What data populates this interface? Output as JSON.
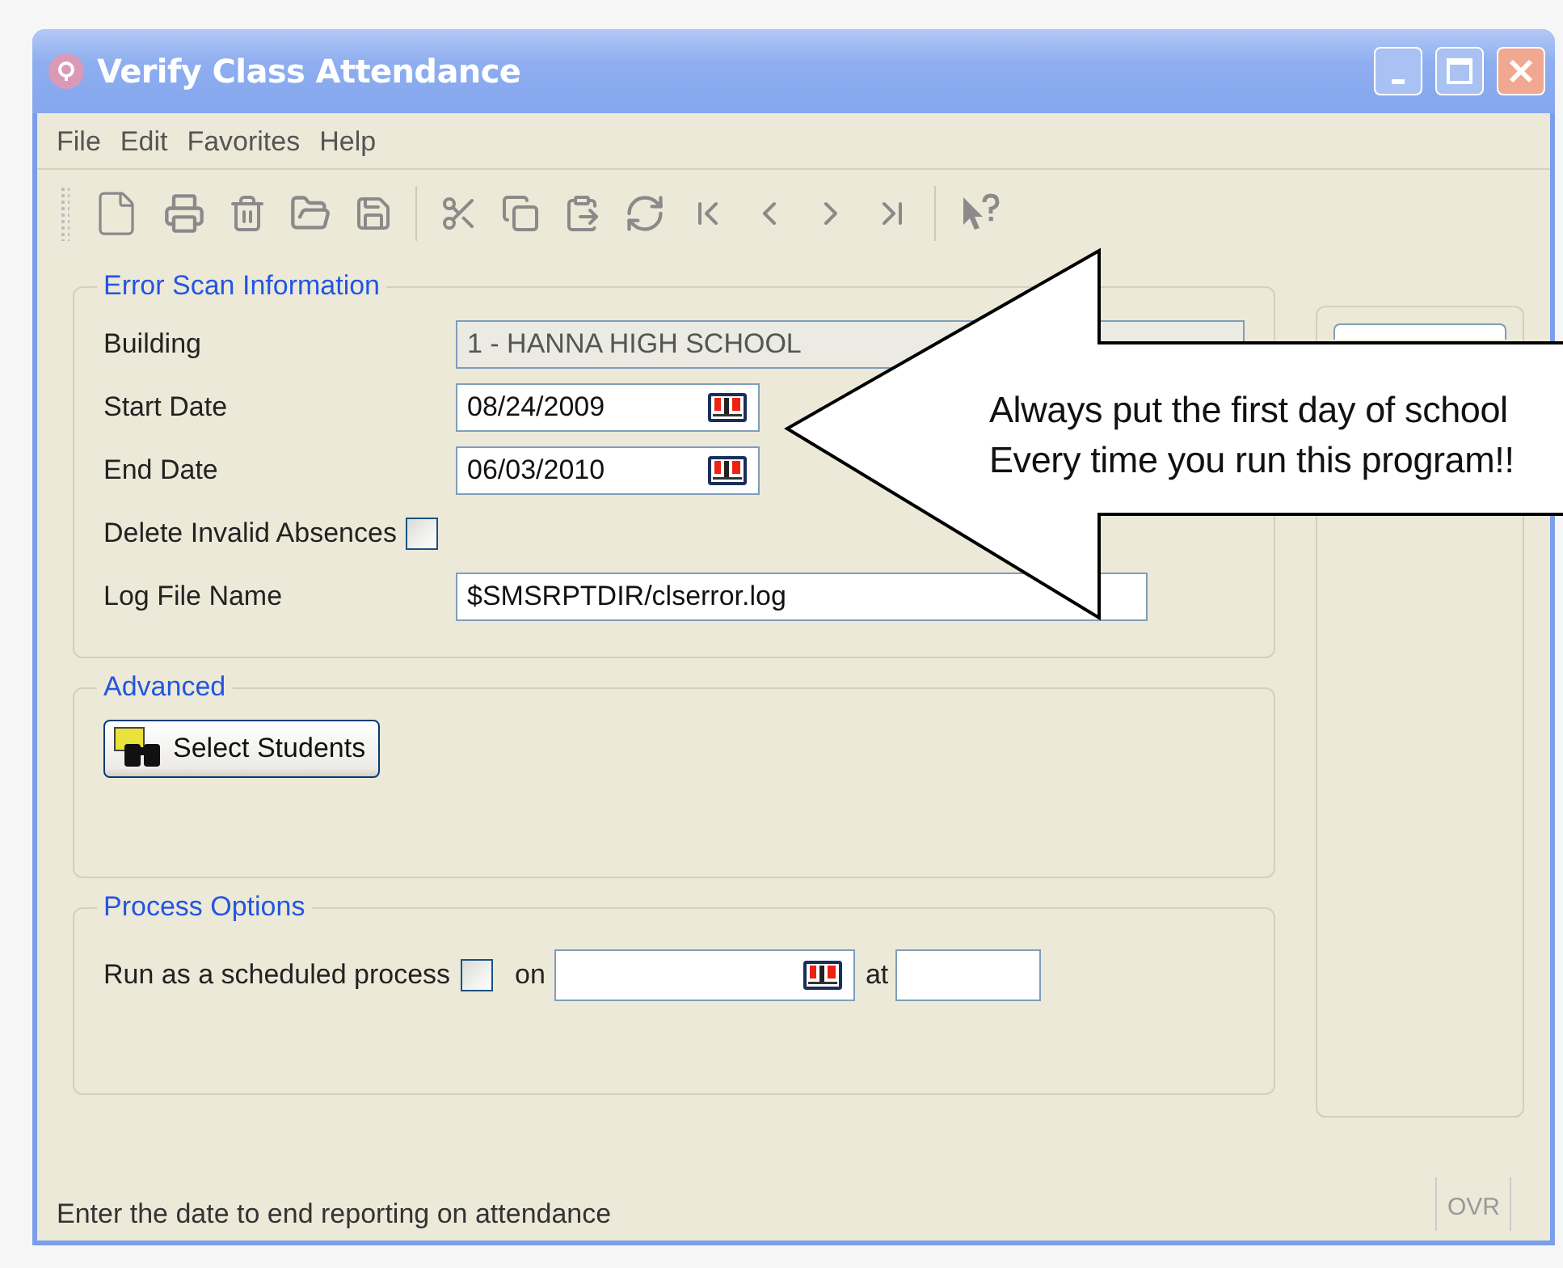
{
  "window": {
    "title": "Verify Class Attendance"
  },
  "menu": [
    "File",
    "Edit",
    "Favorites",
    "Help"
  ],
  "error_scan": {
    "title": "Error Scan Information",
    "building": {
      "label": "Building",
      "value": "1 - HANNA HIGH SCHOOL",
      "disabled": true
    },
    "start_date": {
      "label": "Start Date",
      "value": "08/24/2009"
    },
    "end_date": {
      "label": "End Date",
      "value": "06/03/2010"
    },
    "delete_invalid": {
      "label": "Delete Invalid Absences",
      "checked": false
    },
    "log_file": {
      "label": "Log File Name",
      "value": "$SMSRPTDIR/clserror.log"
    }
  },
  "advanced": {
    "title": "Advanced",
    "button": "Select Students"
  },
  "process_options": {
    "title": "Process Options",
    "scheduled": {
      "label": "Run as a scheduled process",
      "checked": false
    },
    "on_label": "on",
    "at_label": "at"
  },
  "status_bar": {
    "message": "Enter the date to end reporting on attendance",
    "mode": "OVR"
  },
  "callout": {
    "lines": [
      "Always put the first day of school",
      "Every time you run this program!!"
    ]
  }
}
